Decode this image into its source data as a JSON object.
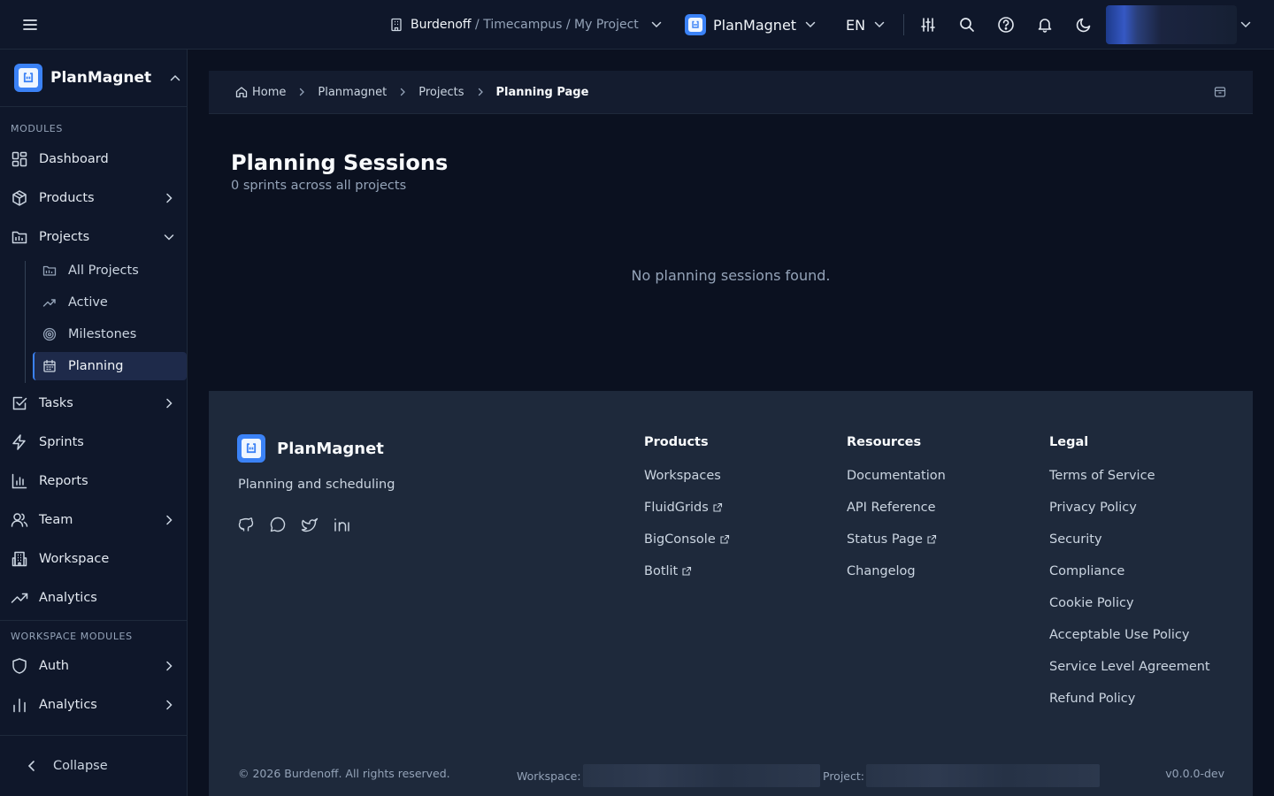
{
  "topbar": {
    "context_org": "Burdenoff",
    "context_path": "/ Timecampus / My Project",
    "app_name": "PlanMagnet",
    "language": "EN",
    "icons": [
      "menu-icon",
      "building-icon",
      "chevron-down-icon",
      "sliders-icon",
      "search-icon",
      "help-icon",
      "bell-icon",
      "moon-icon"
    ]
  },
  "sidebar": {
    "app_name": "PlanMagnet",
    "modules_label": "MODULES",
    "items": [
      {
        "label": "Dashboard",
        "icon": "grid-icon"
      },
      {
        "label": "Products",
        "icon": "box-icon"
      },
      {
        "label": "Projects",
        "icon": "folder-icon"
      },
      {
        "label": "Tasks",
        "icon": "checkbox-icon"
      },
      {
        "label": "Sprints",
        "icon": "zap-icon"
      },
      {
        "label": "Reports",
        "icon": "bar-chart-icon"
      },
      {
        "label": "Team",
        "icon": "users-icon"
      },
      {
        "label": "Workspace",
        "icon": "building-icon"
      },
      {
        "label": "Analytics",
        "icon": "trend-icon"
      }
    ],
    "project_children": [
      {
        "label": "All Projects",
        "icon": "folder-open-icon"
      },
      {
        "label": "Active",
        "icon": "trend-icon"
      },
      {
        "label": "Milestones",
        "icon": "target-icon"
      },
      {
        "label": "Planning",
        "icon": "calendar-icon",
        "active": true
      }
    ],
    "workspace_modules_label": "WORKSPACE MODULES",
    "workspace_items": [
      {
        "label": "Auth",
        "icon": "shield-icon"
      },
      {
        "label": "Analytics",
        "icon": "bar-chart-icon"
      }
    ],
    "collapse_label": "Collapse"
  },
  "breadcrumb": {
    "items": [
      "Home",
      "Planmagnet",
      "Projects"
    ],
    "current": "Planning Page"
  },
  "main": {
    "title": "Planning Sessions",
    "subtitle": "0 sprints across all projects",
    "empty_message": "No planning sessions found."
  },
  "footer": {
    "brand": "PlanMagnet",
    "tagline": "Planning and scheduling",
    "socials": [
      "github-icon",
      "chat-icon",
      "twitter-icon",
      "linkedin-icon"
    ],
    "columns": [
      {
        "title": "Products",
        "links": [
          {
            "label": "Workspaces",
            "external": false
          },
          {
            "label": "FluidGrids",
            "external": true
          },
          {
            "label": "BigConsole",
            "external": true
          },
          {
            "label": "Botlit",
            "external": true
          }
        ]
      },
      {
        "title": "Resources",
        "links": [
          {
            "label": "Documentation",
            "external": false
          },
          {
            "label": "API Reference",
            "external": false
          },
          {
            "label": "Status Page",
            "external": true
          },
          {
            "label": "Changelog",
            "external": false
          }
        ]
      },
      {
        "title": "Legal",
        "links": [
          {
            "label": "Terms of Service",
            "external": false
          },
          {
            "label": "Privacy Policy",
            "external": false
          },
          {
            "label": "Security",
            "external": false
          },
          {
            "label": "Compliance",
            "external": false
          },
          {
            "label": "Cookie Policy",
            "external": false
          },
          {
            "label": "Acceptable Use Policy",
            "external": false
          },
          {
            "label": "Service Level Agreement",
            "external": false
          },
          {
            "label": "Refund Policy",
            "external": false
          }
        ]
      }
    ],
    "copyright": "© 2026 Burdenoff. All rights reserved.",
    "workspace_label": "Workspace:",
    "project_label": "Project:",
    "version": "v0.0.0-dev"
  },
  "colors": {
    "accent": "#3b82f6",
    "background": "#0b1120",
    "surface": "#0f172a",
    "footer": "#1e293b"
  }
}
